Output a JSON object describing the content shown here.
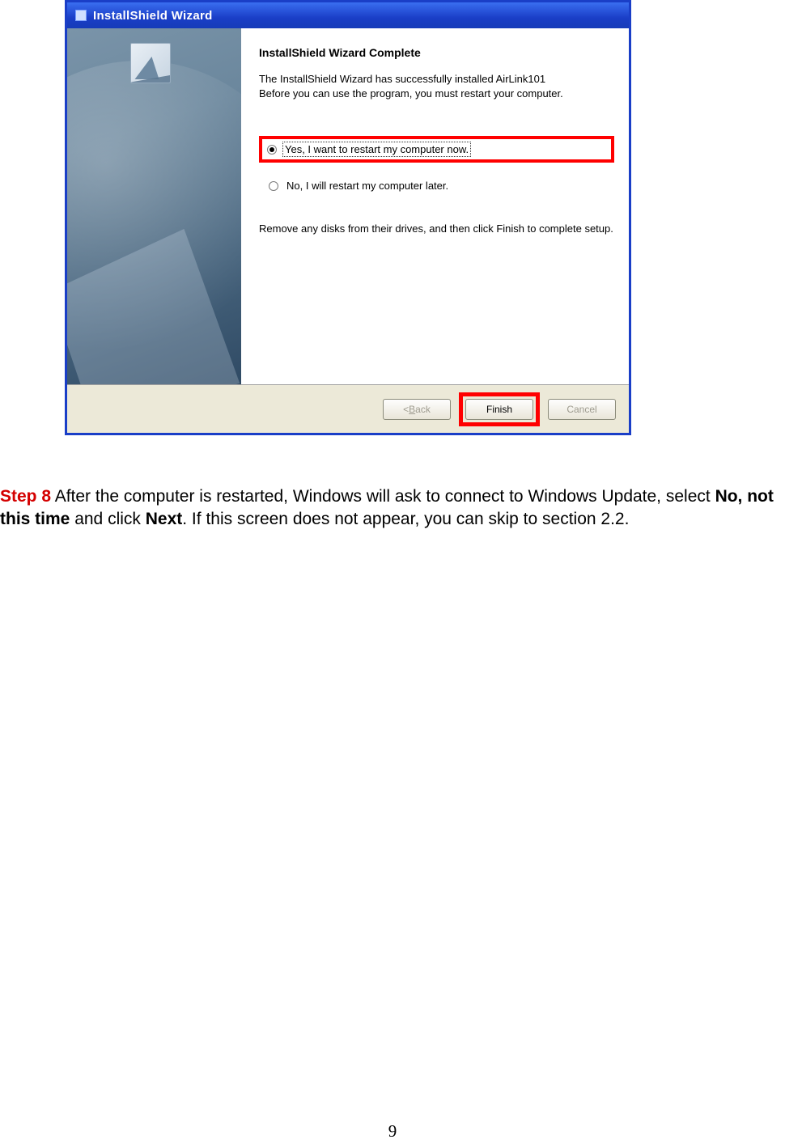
{
  "window": {
    "title": "InstallShield Wizard",
    "heading": "InstallShield Wizard Complete",
    "desc_line1": "The InstallShield Wizard has successfully installed AirLink101",
    "desc_line2": "Before you can use the program, you must restart your computer.",
    "radio_yes": "Yes, I want to restart my computer now.",
    "radio_no": "No, I will restart my computer later.",
    "remove_disks": "Remove any disks from their drives, and then click Finish to complete setup."
  },
  "buttons": {
    "back_prefix": "< ",
    "back_u": "B",
    "back_rest": "ack",
    "finish": "Finish",
    "cancel": "Cancel"
  },
  "step": {
    "label": "Step 8",
    "text_1": " After the computer is restarted, Windows will ask to connect to Windows Update, select ",
    "bold_1": "No, not this time",
    "text_2": " and click ",
    "bold_2": "Next",
    "text_3": ". If this screen does not appear, you can skip to section 2.2."
  },
  "page_number": "9"
}
